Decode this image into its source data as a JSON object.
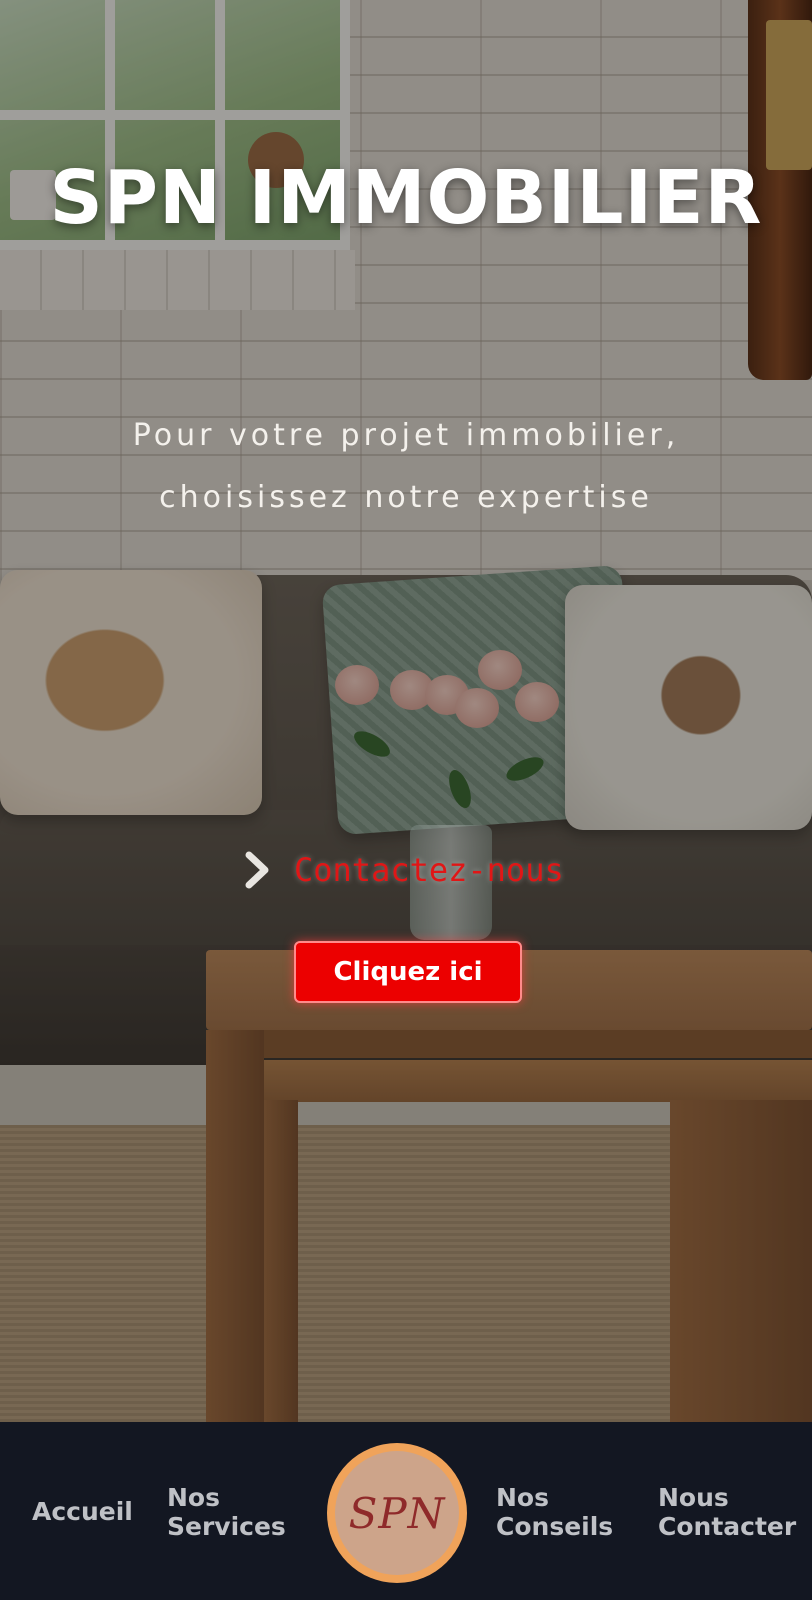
{
  "hero": {
    "title": "SPN IMMOBILIER",
    "tagline_line1": "Pour votre projet immobilier,",
    "tagline_line2": "choisissez notre expertise",
    "contact_link": "Contactez-nous",
    "cta_button": "Cliquez ici",
    "background_image": "living-room-sofa-scene"
  },
  "nav": {
    "items": [
      {
        "line1": "Accueil",
        "line2": ""
      },
      {
        "line1": "Nos",
        "line2": "Services"
      },
      {
        "line1": "Nos",
        "line2": "Conseils"
      },
      {
        "line1": "Nous",
        "line2": "Contacter"
      }
    ],
    "logo_text": "SPN"
  },
  "colors": {
    "accent_red": "#e01616",
    "nav_background": "#131722",
    "logo_ring": "#f0a35a",
    "logo_text": "#8f2a2a"
  },
  "icons": {
    "contact_chevron": "chevron-right-icon"
  }
}
